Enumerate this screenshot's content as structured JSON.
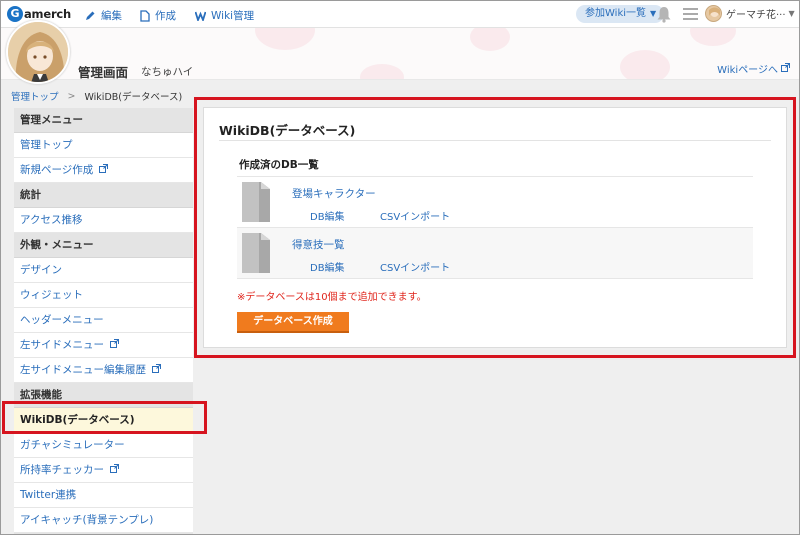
{
  "topbar": {
    "logo_mark": "G",
    "logo_text": "amerch",
    "nav": [
      {
        "label": "編集",
        "icon": "pencil-icon"
      },
      {
        "label": "作成",
        "icon": "document-icon"
      },
      {
        "label": "Wiki管理",
        "icon": "w-icon"
      }
    ],
    "wiki_list_label": "参加Wiki一覧",
    "user_name": "ゲーマチ花···"
  },
  "header": {
    "title": "管理画面",
    "user": "なちゅハイ",
    "wiki_page_link": "Wikiページへ"
  },
  "breadcrumb": {
    "home": "管理トップ",
    "current": "WikiDB(データベース)"
  },
  "sidebar": {
    "sections": [
      {
        "heading": "管理メニュー",
        "items": [
          {
            "label": "管理トップ",
            "external": false
          },
          {
            "label": "新規ページ作成",
            "external": true
          }
        ]
      },
      {
        "heading": "統計",
        "items": [
          {
            "label": "アクセス推移",
            "external": false
          }
        ]
      },
      {
        "heading": "外観・メニュー",
        "items": [
          {
            "label": "デザイン",
            "external": false
          },
          {
            "label": "ウィジェット",
            "external": false
          },
          {
            "label": "ヘッダーメニュー",
            "external": false
          },
          {
            "label": "左サイドメニュー",
            "external": true
          },
          {
            "label": "左サイドメニュー編集履歴",
            "external": true
          }
        ]
      },
      {
        "heading": "拡張機能",
        "items": [
          {
            "label": "WikiDB(データベース)",
            "external": false,
            "active": true
          },
          {
            "label": "ガチャシミュレーター",
            "external": false
          },
          {
            "label": "所持率チェッカー",
            "external": true
          },
          {
            "label": "Twitter連携",
            "external": false
          },
          {
            "label": "アイキャッチ(背景テンプレ)",
            "external": false
          }
        ]
      }
    ]
  },
  "main": {
    "title": "WikiDB(データベース)",
    "list_title": "作成済のDB一覧",
    "databases": [
      {
        "name": "登場キャラクター",
        "edit_label": "DB編集",
        "csv_label": "CSVインポート"
      },
      {
        "name": "得意技一覧",
        "edit_label": "DB編集",
        "csv_label": "CSVインポート"
      }
    ],
    "note": "※データベースは10個まで追加できます。",
    "create_button": "データベース作成"
  },
  "colors": {
    "link": "#2a6ebb",
    "highlight_box": "#d6141f",
    "primary_button": "#f07b1e",
    "note": "#e0261d",
    "active_item_bg": "#fdf8dc"
  }
}
